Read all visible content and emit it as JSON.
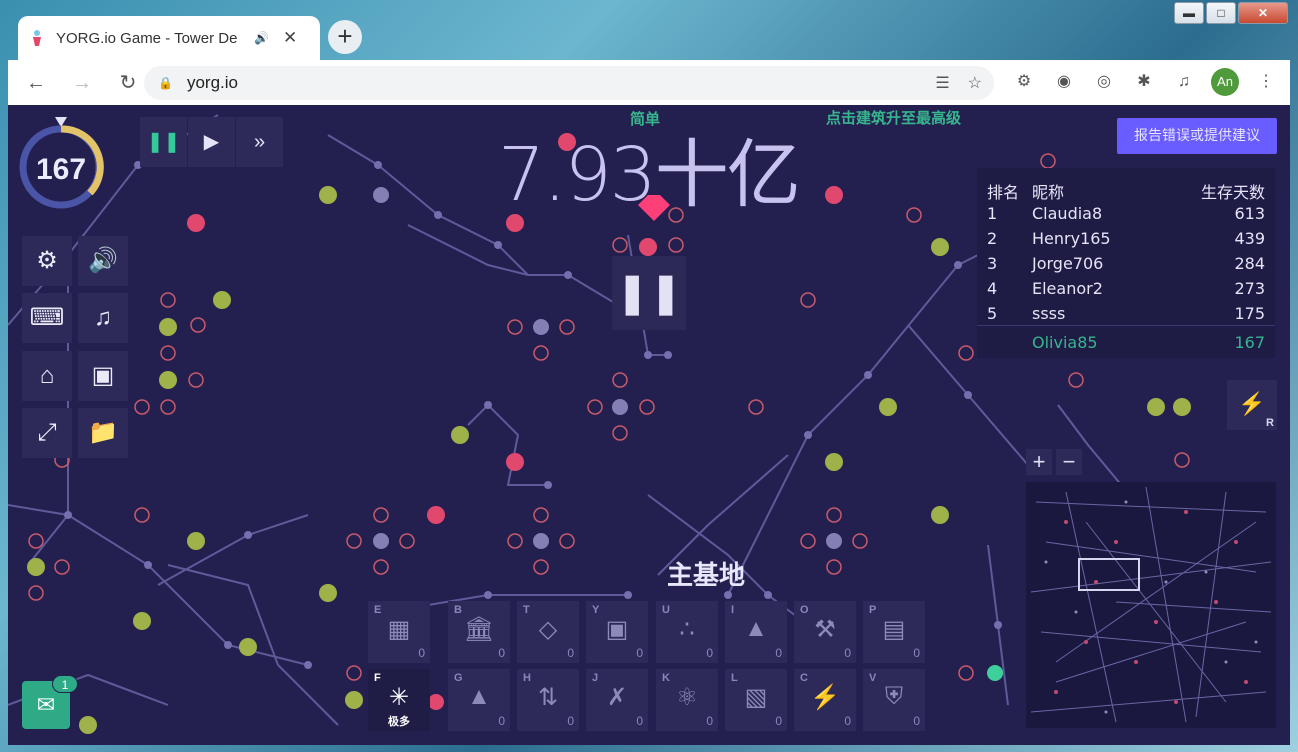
{
  "browser": {
    "tab_title": "YORG.io Game - Tower De",
    "url": "yorg.io",
    "avatar_initials": "An"
  },
  "game": {
    "difficulty": "简单",
    "hint": "点击建筑升至最高级",
    "money": "7.93十亿",
    "report_button": "报告错误或提供建议",
    "wave": "167",
    "base_label": "主基地",
    "chat_count": "1",
    "leaderboard": {
      "headers": {
        "rank": "排名",
        "name": "昵称",
        "days": "生存天数"
      },
      "rows": [
        {
          "rank": "1",
          "name": "Claudia8",
          "days": "613"
        },
        {
          "rank": "2",
          "name": "Henry165",
          "days": "439"
        },
        {
          "rank": "3",
          "name": "Jorge706",
          "days": "284"
        },
        {
          "rank": "4",
          "name": "Eleanor2",
          "days": "273"
        },
        {
          "rank": "5",
          "name": "ssss",
          "days": "175"
        }
      ],
      "me": {
        "name": "Olivia85",
        "days": "167"
      }
    },
    "power_key": "R",
    "buildings": [
      {
        "key": "E",
        "count": "0",
        "icon": "wall-icon"
      },
      {
        "key": "B",
        "count": "0",
        "icon": "bank-icon"
      },
      {
        "key": "T",
        "count": "0",
        "icon": "gem-icon"
      },
      {
        "key": "Y",
        "count": "0",
        "icon": "minecart-icon"
      },
      {
        "key": "U",
        "count": "0",
        "icon": "iron-icon"
      },
      {
        "key": "I",
        "count": "0",
        "icon": "cannon-icon"
      },
      {
        "key": "O",
        "count": "0",
        "icon": "hammer-icon"
      },
      {
        "key": "P",
        "count": "0",
        "icon": "factory-icon"
      },
      {
        "key": "F",
        "count": "",
        "icon": "transporter-icon",
        "level": "极多"
      },
      {
        "key": "G",
        "count": "0",
        "icon": "arrow-tower-icon"
      },
      {
        "key": "H",
        "count": "0",
        "icon": "triple-arrow-icon"
      },
      {
        "key": "J",
        "count": "0",
        "icon": "crossbow-icon"
      },
      {
        "key": "K",
        "count": "0",
        "icon": "atom-icon"
      },
      {
        "key": "L",
        "count": "0",
        "icon": "lab-icon"
      },
      {
        "key": "C",
        "count": "0",
        "icon": "lightning-icon"
      },
      {
        "key": "V",
        "count": "0",
        "icon": "shield-icon"
      }
    ]
  },
  "colors": {
    "background": "#232050",
    "accent_green": "#37b58d",
    "button_purple": "#6a5dff",
    "node_pink": "#e0486e",
    "node_olive": "#9fb24a"
  }
}
